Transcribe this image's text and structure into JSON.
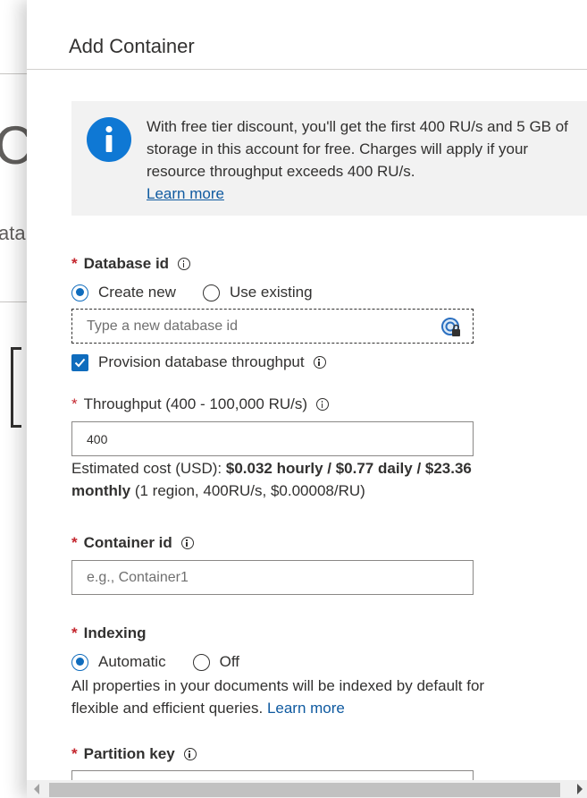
{
  "background": {
    "big_text": "C",
    "sub_text": "ata"
  },
  "panel": {
    "title": "Add Container"
  },
  "info": {
    "message": "With free tier discount, you'll get the first 400 RU/s and 5 GB of storage in this account for free. Charges will apply if your resource throughput exceeds 400 RU/s.",
    "link": "Learn more",
    "icon": "info-icon"
  },
  "database": {
    "label": "Database id",
    "options": [
      "Create new",
      "Use existing"
    ],
    "selected": "Create new",
    "placeholder": "Type a new database id",
    "provision_label": "Provision database throughput",
    "provision_checked": true
  },
  "throughput": {
    "label": "Throughput (400 - 100,000 RU/s)",
    "value": "400",
    "cost_prefix": "Estimated cost (USD): ",
    "cost_bold_line1": "$0.032 hourly / $0.77 daily / $23.36",
    "cost_bold_line2": "monthly",
    "cost_suffix": " (1 region, 400RU/s, $0.00008/RU)"
  },
  "container": {
    "label": "Container id",
    "placeholder": "e.g., Container1"
  },
  "indexing": {
    "label": "Indexing",
    "options": [
      "Automatic",
      "Off"
    ],
    "selected": "Automatic",
    "description": "All properties in your documents will be indexed by default for flexible and efficient queries. ",
    "link": "Learn more"
  },
  "partition": {
    "label": "Partition key"
  },
  "colors": {
    "accent": "#0f6cbd",
    "link": "#0f5aa0",
    "required": "#c4262e",
    "info_bg": "#f2f2f2"
  }
}
